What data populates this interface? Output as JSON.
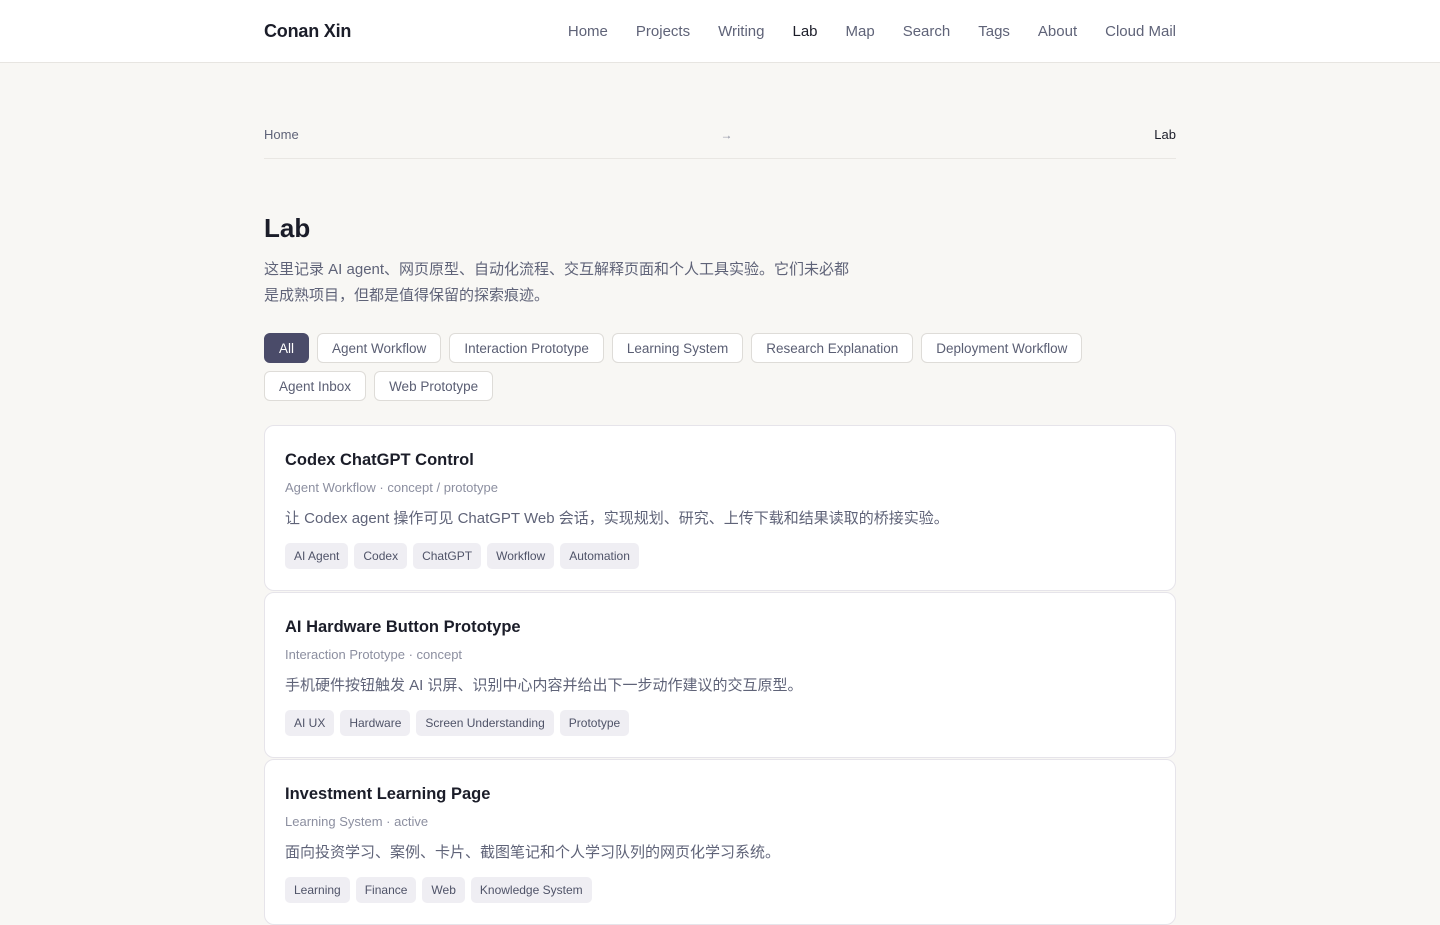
{
  "header": {
    "brand": "Conan Xin",
    "nav": [
      {
        "label": "Home"
      },
      {
        "label": "Projects"
      },
      {
        "label": "Writing"
      },
      {
        "label": "Lab",
        "active": true
      },
      {
        "label": "Map"
      },
      {
        "label": "Search"
      },
      {
        "label": "Tags"
      },
      {
        "label": "About"
      },
      {
        "label": "Cloud Mail"
      }
    ]
  },
  "breadcrumb": {
    "home": "Home",
    "separator": "→",
    "current": "Lab"
  },
  "page": {
    "title": "Lab",
    "intro": "这里记录 AI agent、网页原型、自动化流程、交互解释页面和个人工具实验。它们未必都是成熟项目，但都是值得保留的探索痕迹。"
  },
  "filters": [
    {
      "label": "All",
      "active": true
    },
    {
      "label": "Agent Workflow"
    },
    {
      "label": "Interaction Prototype"
    },
    {
      "label": "Learning System"
    },
    {
      "label": "Research Explanation"
    },
    {
      "label": "Deployment Workflow"
    },
    {
      "label": "Agent Inbox"
    },
    {
      "label": "Web Prototype"
    }
  ],
  "cards": [
    {
      "title": "Codex ChatGPT Control",
      "meta": "Agent Workflow · concept / prototype",
      "description": "让 Codex agent 操作可见 ChatGPT Web 会话，实现规划、研究、上传下载和结果读取的桥接实验。",
      "tags": [
        "AI Agent",
        "Codex",
        "ChatGPT",
        "Workflow",
        "Automation"
      ]
    },
    {
      "title": "AI Hardware Button Prototype",
      "meta": "Interaction Prototype · concept",
      "description": "手机硬件按钮触发 AI 识屏、识别中心内容并给出下一步动作建议的交互原型。",
      "tags": [
        "AI UX",
        "Hardware",
        "Screen Understanding",
        "Prototype"
      ]
    },
    {
      "title": "Investment Learning Page",
      "meta": "Learning System · active",
      "description": "面向投资学习、案例、卡片、截图笔记和个人学习队列的网页化学习系统。",
      "tags": [
        "Learning",
        "Finance",
        "Web",
        "Knowledge System"
      ]
    }
  ],
  "colors": {
    "background": "#f8f7f4",
    "accent": "#4a4b69",
    "text": "#1b1d29",
    "muted": "#5f6378"
  }
}
